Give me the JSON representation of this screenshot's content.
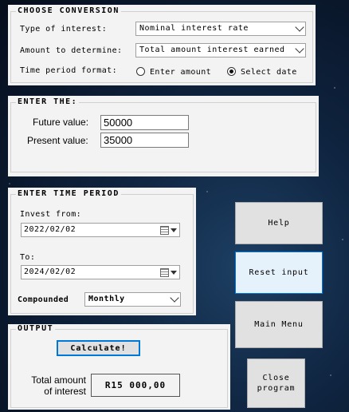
{
  "conversion": {
    "title": "CHOOSE CONVERSION",
    "type_label": "Type of interest:",
    "type_value": "Nominal interest rate",
    "amount_label": "Amount to determine:",
    "amount_value": "Total amount interest earned",
    "format_label": "Time period format:",
    "format_options": [
      "Enter amount",
      "Select date"
    ],
    "format_selected": "Select date"
  },
  "enter": {
    "title": "ENTER THE:",
    "future_label": "Future value:",
    "future_value": "50000",
    "present_label": "Present value:",
    "present_value": "35000"
  },
  "time": {
    "title": "ENTER TIME PERIOD",
    "from_label": "Invest from:",
    "from_value": "2022/02/02",
    "to_label": "To:",
    "to_value": "2024/02/02",
    "compounded_label": "Compounded",
    "compounded_value": "Monthly"
  },
  "output": {
    "title": "OUTPUT",
    "calculate_label": "Calculate!",
    "total_label_line1": "Total amount",
    "total_label_line2": "of interest",
    "total_value": "R15 000,00"
  },
  "buttons": {
    "help": "Help",
    "reset": "Reset input",
    "main_menu": "Main Menu",
    "close_line1": "Close",
    "close_line2": "program"
  }
}
